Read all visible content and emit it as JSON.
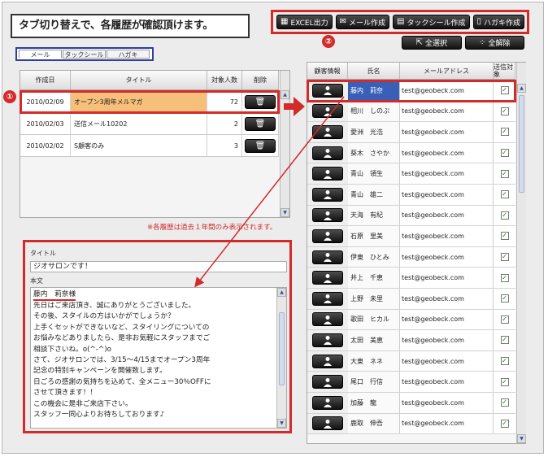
{
  "header": {
    "title": "タブ切り替えで、各履歴が確認頂けます。",
    "actions": [
      {
        "icon": "excel-icon",
        "label": "EXCEL出力"
      },
      {
        "icon": "mail-icon",
        "label": "メール作成"
      },
      {
        "icon": "tag-seal-icon",
        "label": "タックシール作成"
      },
      {
        "icon": "postcard-icon",
        "label": "ハガキ作成"
      }
    ],
    "select_all": "全選択",
    "deselect_all": "全解除"
  },
  "markers": {
    "one": "①",
    "two": "②"
  },
  "tabs": [
    "メール",
    "タックシール",
    "ハガキ"
  ],
  "history": {
    "columns": {
      "date": "作成日",
      "title": "タイトル",
      "count": "対象人数",
      "delete": "削除"
    },
    "rows": [
      {
        "date": "2010/02/09",
        "title": "オープン3周年メルマガ",
        "count": "72"
      },
      {
        "date": "2010/02/03",
        "title": "送信メール10202",
        "count": "2"
      },
      {
        "date": "2010/02/02",
        "title": "S顧客のみ",
        "count": "3"
      }
    ],
    "note": "※各履歴は過去１年間のみ表示されます。"
  },
  "detail": {
    "subject_label": "タイトル",
    "subject": "ジオサロンです！",
    "body_label": "本文",
    "body_lines": [
      "藤内　莉奈様",
      "先日はご来店頂き、誠にありがとうございました。",
      "その後、スタイルの方はいかがでしょうか？",
      "上手くセットができないなど、スタイリングについての",
      "お悩みなどありましたら、是非お気軽にスタッフまでご",
      "相談下さいね。o(^-^)o",
      "さて、ジオサロンでは、3/15～4/15までオープン3周年",
      "記念の特別キャンペーンを開催致します。",
      "日ごろの感謝の気持ちを込めて、全メニュー30％OFFに",
      "させて頂きます！！",
      "この機会に是非ご来店下さい。",
      "スタッフ一同心よりお待ちしております♪"
    ]
  },
  "customers": {
    "columns": {
      "info": "顧客情報",
      "name": "氏名",
      "email": "メールアドレス",
      "send": "送信対象"
    },
    "rows": [
      {
        "name": "藤内　莉奈",
        "email": "test@geobeck.com",
        "checked": true
      },
      {
        "name": "相川　しのぶ",
        "email": "test@geobeck.com",
        "checked": true
      },
      {
        "name": "愛洲　光浩",
        "email": "test@geobeck.com",
        "checked": true
      },
      {
        "name": "葵木　さやか",
        "email": "test@geobeck.com",
        "checked": true
      },
      {
        "name": "青山　領生",
        "email": "test@geobeck.com",
        "checked": true
      },
      {
        "name": "青山　雄二",
        "email": "test@geobeck.com",
        "checked": true
      },
      {
        "name": "天海　有紀",
        "email": "test@geobeck.com",
        "checked": true
      },
      {
        "name": "石原　里美",
        "email": "test@geobeck.com",
        "checked": true
      },
      {
        "name": "伊東　ひとみ",
        "email": "test@geobeck.com",
        "checked": true
      },
      {
        "name": "井上　千恵",
        "email": "test@geobeck.com",
        "checked": true
      },
      {
        "name": "上野　未里",
        "email": "test@geobeck.com",
        "checked": true
      },
      {
        "name": "歌田　ヒカル",
        "email": "test@geobeck.com",
        "checked": true
      },
      {
        "name": "太田　美恵",
        "email": "test@geobeck.com",
        "checked": true
      },
      {
        "name": "大東　ネネ",
        "email": "test@geobeck.com",
        "checked": true
      },
      {
        "name": "尾口　行信",
        "email": "test@geobeck.com",
        "checked": true
      },
      {
        "name": "加藤　龍",
        "email": "test@geobeck.com",
        "checked": true
      },
      {
        "name": "鹿取　伸吾",
        "email": "test@geobeck.com",
        "checked": true
      }
    ]
  },
  "colors": {
    "highlight": "#d32a2a",
    "tab_border": "#2f3f9e",
    "selected_name_bg": "#3a5fb7",
    "selected_title_bg": "#f6c07a"
  }
}
